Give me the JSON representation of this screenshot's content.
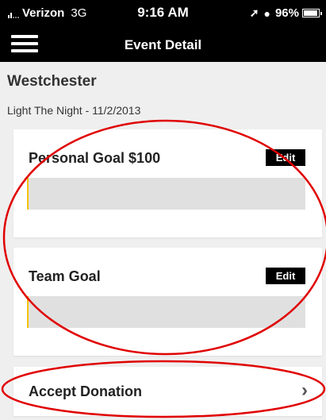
{
  "status_bar": {
    "carrier": "Verizon",
    "network": "3G",
    "time": "9:16 AM",
    "battery": "96%",
    "battery_level": 0.96,
    "location_icon": "location-arrow-icon",
    "alarm_icon": "alarm-clock-icon"
  },
  "nav": {
    "title": "Event Detail",
    "menu_icon": "hamburger-menu-icon"
  },
  "event": {
    "name": "Westchester",
    "subtitle": "Light The Night - 11/2/2013"
  },
  "personal_goal": {
    "title": "Personal Goal $100",
    "edit_label": "Edit",
    "progress": 0.005
  },
  "team_goal": {
    "title": "Team Goal",
    "edit_label": "Edit",
    "progress": 0.005
  },
  "donation": {
    "label": "Accept Donation",
    "chevron": "›"
  },
  "colors": {
    "progress_fill": "#f2c200",
    "annotation": "#e00000",
    "background": "#efefef"
  }
}
